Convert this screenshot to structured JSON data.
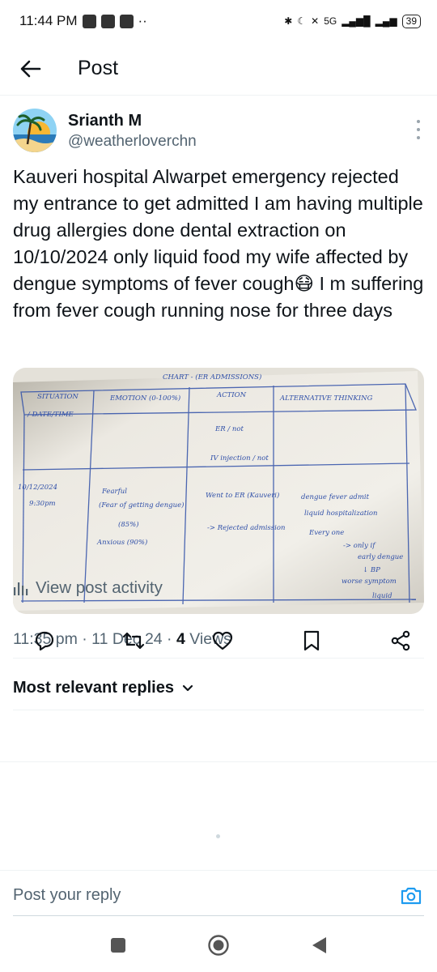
{
  "status_bar": {
    "time": "11:44 PM",
    "dots": "··",
    "network": "5G",
    "battery": "39"
  },
  "header": {
    "title": "Post"
  },
  "post": {
    "author_name": "Srianth M",
    "author_handle": "@weatherloverchn",
    "text": "Kauveri hospital Alwarpet emergency rejected my entrance to get admitted I am having multiple drug allergies done dental extraction on 10/10/2024 only liquid food my wife affected by dengue symptoms of fever cough😷 I m suffering from fever cough running nose for three days",
    "timestamp": "11:35 pm · 11 Dec 24 · ",
    "views_count": "4",
    "views_label": " Views"
  },
  "media": {
    "chart_title": "CHART - (ER ADMISSIONS)",
    "columns": [
      "SITUATION",
      "EMOTION (0-100%)",
      "ACTION",
      "ALTERNATIVE THINKING"
    ],
    "row_labels": [
      "/ DATE/TIME"
    ],
    "cells": {
      "date": "10/12/2024",
      "time": "9:30pm",
      "emotion": [
        "Fearful",
        "(Fear of getting dengue)",
        "(85%)",
        "Anxious (90%)"
      ],
      "action": [
        "ER / not",
        "IV injection / not",
        "Went to ER (Kauveri)",
        "-> Rejected admission"
      ],
      "alternative": [
        "dengue fever admit",
        "liquid hospitalization",
        "Every one",
        "-> only if",
        "early dengue",
        "↓ BP",
        "worse symptom",
        "liquid"
      ]
    }
  },
  "activity": {
    "label": "View post activity"
  },
  "replies": {
    "sort_label": "Most relevant replies"
  },
  "reply_box": {
    "placeholder": "Post your reply"
  },
  "colors": {
    "accent": "#1d9bf0",
    "secondary_text": "#536471",
    "primary_text": "#0f1419"
  }
}
